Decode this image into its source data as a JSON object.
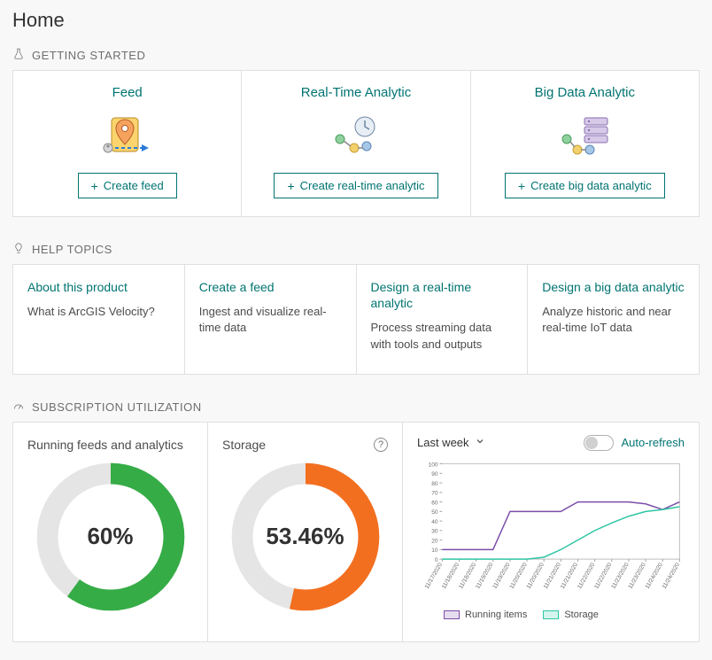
{
  "page_title": "Home",
  "sections": {
    "getting_started_label": "GETTING STARTED",
    "help_topics_label": "HELP TOPICS",
    "subscription_label": "SUBSCRIPTION UTILIZATION"
  },
  "getting_started": [
    {
      "title": "Feed",
      "button": "Create feed"
    },
    {
      "title": "Real-Time Analytic",
      "button": "Create real-time analytic"
    },
    {
      "title": "Big Data Analytic",
      "button": "Create big data analytic"
    }
  ],
  "help_topics": [
    {
      "title": "About this product",
      "desc": "What is ArcGIS Velocity?"
    },
    {
      "title": "Create a feed",
      "desc": "Ingest and visualize real-time data"
    },
    {
      "title": "Design a real-time analytic",
      "desc": "Process streaming data with tools and outputs"
    },
    {
      "title": "Design a big data analytic",
      "desc": "Analyze historic and near real-time IoT data"
    }
  ],
  "gauges": {
    "running": {
      "title": "Running feeds and analytics",
      "value_label": "60%",
      "pct": 60,
      "color": "#35ac46"
    },
    "storage": {
      "title": "Storage",
      "value_label": "53.46%",
      "pct": 53.46,
      "color": "#f36f20"
    }
  },
  "chart_controls": {
    "range_label": "Last week",
    "auto_refresh_label": "Auto-refresh",
    "auto_refresh_on": false
  },
  "chart_data": {
    "type": "line",
    "xlabel": "",
    "ylabel": "",
    "ylim": [
      0,
      100
    ],
    "y_ticks": [
      0,
      10,
      20,
      30,
      40,
      50,
      60,
      70,
      80,
      90,
      100
    ],
    "categories": [
      "11/17/2020",
      "11/18/2020",
      "11/18/2020",
      "11/19/2020",
      "11/19/2020",
      "11/20/2020",
      "11/20/2020",
      "11/21/2020",
      "11/21/2020",
      "11/22/2020",
      "11/22/2020",
      "11/23/2020",
      "11/23/2020",
      "11/24/2020",
      "11/24/2020"
    ],
    "series": [
      {
        "name": "Running items",
        "color": "#7b4ea8",
        "values": [
          10,
          10,
          10,
          10,
          50,
          50,
          50,
          50,
          60,
          60,
          60,
          60,
          58,
          52,
          60
        ]
      },
      {
        "name": "Storage",
        "color": "#2fc6a4",
        "values": [
          0,
          0,
          0,
          0,
          0,
          0,
          2,
          10,
          20,
          30,
          38,
          45,
          50,
          52,
          55
        ]
      }
    ]
  }
}
